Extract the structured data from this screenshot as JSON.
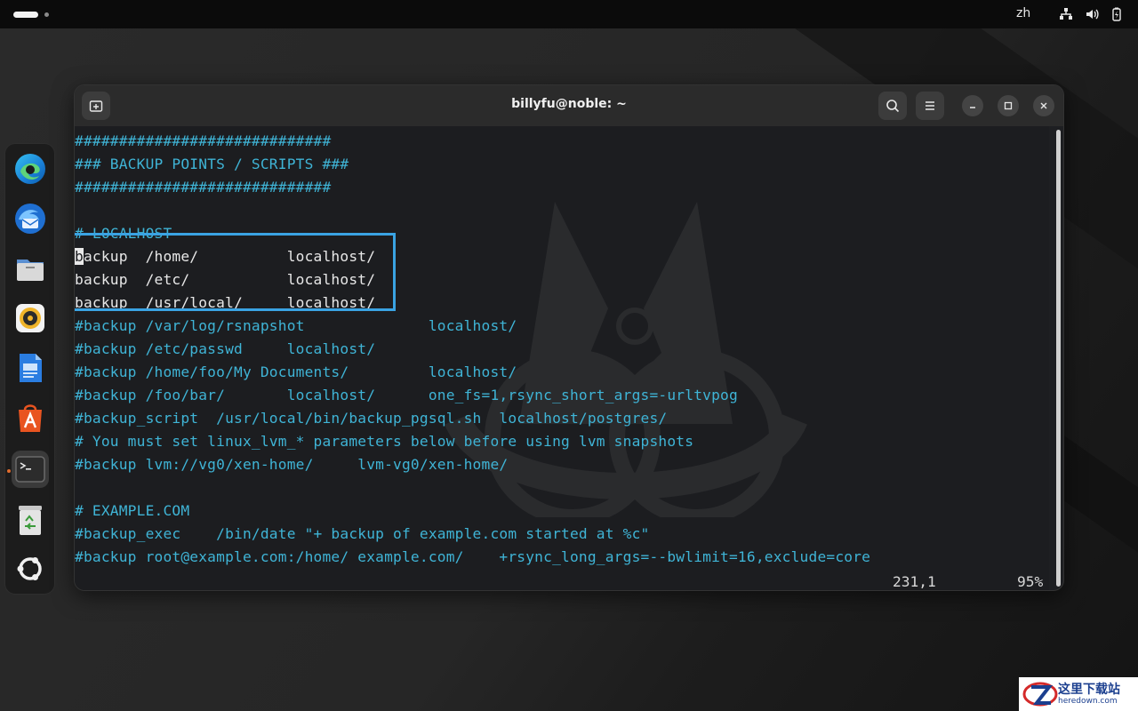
{
  "topbar": {
    "language": "zh",
    "icons": [
      "network-icon",
      "volume-icon",
      "battery-icon"
    ]
  },
  "dock": {
    "apps": [
      {
        "name": "Microsoft Edge",
        "icon": "edge-icon"
      },
      {
        "name": "Thunderbird",
        "icon": "thunderbird-icon"
      },
      {
        "name": "Files",
        "icon": "files-icon"
      },
      {
        "name": "Rhythmbox",
        "icon": "rhythmbox-icon"
      },
      {
        "name": "LibreOffice Writer",
        "icon": "writer-icon"
      },
      {
        "name": "App Center",
        "icon": "app-center-icon"
      },
      {
        "name": "Terminal",
        "icon": "terminal-icon",
        "active": true
      },
      {
        "name": "Trash",
        "icon": "trash-icon"
      },
      {
        "name": "Show Apps",
        "icon": "ubuntu-icon"
      }
    ]
  },
  "terminal": {
    "title": "billyfu@noble: ~",
    "lines": [
      "#############################",
      "### BACKUP POINTS / SCRIPTS ###",
      "#############################",
      "",
      "# LOCALHOST",
      "backup  /home/          localhost/",
      "backup  /etc/           localhost/",
      "backup  /usr/local/     localhost/",
      "#backup /var/log/rsnapshot              localhost/",
      "#backup /etc/passwd     localhost/",
      "#backup /home/foo/My Documents/         localhost/",
      "#backup /foo/bar/       localhost/      one_fs=1,rsync_short_args=-urltvpog",
      "#backup_script  /usr/local/bin/backup_pgsql.sh  localhost/postgres/",
      "# You must set linux_lvm_* parameters below before using lvm snapshots",
      "#backup lvm://vg0/xen-home/     lvm-vg0/xen-home/",
      "",
      "# EXAMPLE.COM",
      "#backup_exec    /bin/date \"+ backup of example.com started at %c\"",
      "#backup root@example.com:/home/ example.com/    +rsync_long_args=--bwlimit=16,exclude=core"
    ],
    "status_position": "231,1",
    "status_percent": "95%"
  },
  "site_logo": {
    "text": "这里下载站",
    "sub": "heredown.com"
  }
}
